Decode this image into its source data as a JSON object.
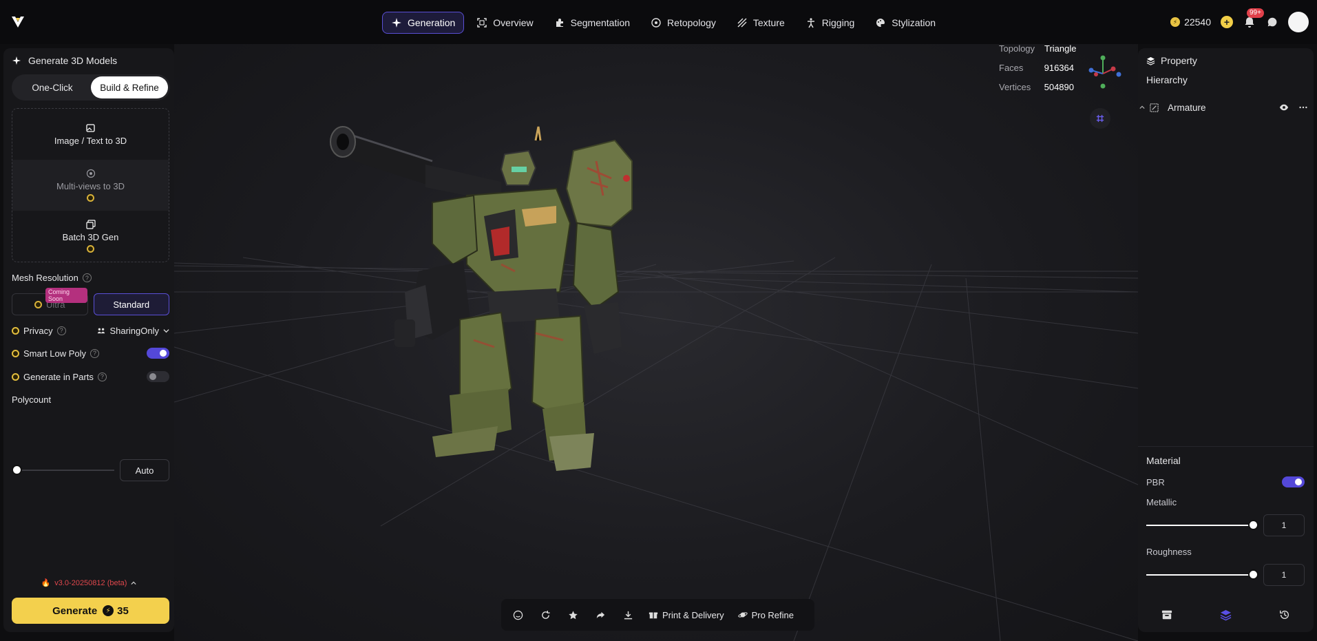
{
  "nav": {
    "items": [
      {
        "label": "Generation",
        "icon": "sparkle-icon"
      },
      {
        "label": "Overview",
        "icon": "scan-icon"
      },
      {
        "label": "Segmentation",
        "icon": "puzzle-icon"
      },
      {
        "label": "Retopology",
        "icon": "mesh-icon"
      },
      {
        "label": "Texture",
        "icon": "texture-icon"
      },
      {
        "label": "Rigging",
        "icon": "rig-icon"
      },
      {
        "label": "Stylization",
        "icon": "palette-icon"
      }
    ],
    "active": "Generation"
  },
  "account": {
    "credits": "22540",
    "notifications": "99+"
  },
  "left_panel": {
    "title": "Generate 3D Models",
    "modes": [
      "One-Click",
      "Build & Refine"
    ],
    "active_mode": "Build & Refine",
    "gen_types": [
      "Image / Text to 3D",
      "Multi-views to 3D",
      "Batch 3D Gen"
    ],
    "mesh_resolution_label": "Mesh Resolution",
    "resolution_options": [
      "Ultra",
      "Standard"
    ],
    "coming_soon": "Coming Soon",
    "active_resolution": "Standard",
    "privacy_label": "Privacy",
    "privacy_value": "SharingOnly",
    "smart_low_poly_label": "Smart Low Poly",
    "smart_low_poly_on": true,
    "generate_in_parts_label": "Generate in Parts",
    "generate_in_parts_on": false,
    "polycount_label": "Polycount",
    "polycount_value": "Auto",
    "version": "v3.0-20250812 (beta)",
    "generate_label": "Generate",
    "generate_cost": "35"
  },
  "viewport": {
    "topology_label": "Topology",
    "topology_value": "Triangle",
    "faces_label": "Faces",
    "faces_value": "916364",
    "vertices_label": "Vertices",
    "vertices_value": "504890",
    "toolbar": {
      "print_label": "Print & Delivery",
      "pro_refine_label": "Pro Refine"
    }
  },
  "right_panel": {
    "title": "Property",
    "hierarchy_label": "Hierarchy",
    "armature_label": "Armature",
    "material_label": "Material",
    "pbr_label": "PBR",
    "pbr_on": true,
    "metallic_label": "Metallic",
    "metallic_value": "1",
    "roughness_label": "Roughness",
    "roughness_value": "1"
  },
  "colors": {
    "accent": "#5448d8",
    "generate": "#f3d04d",
    "robot_body": "#6b7547"
  }
}
